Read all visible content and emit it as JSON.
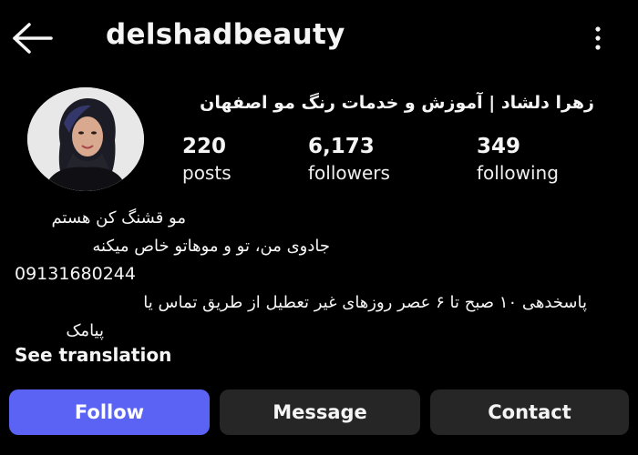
{
  "colors": {
    "background": "#000000",
    "text": "#f5f5f5",
    "follow_button": "#5a63f4",
    "secondary_button": "#262626"
  },
  "header": {
    "back_icon": "arrow-left-icon",
    "username": "delshadbeauty",
    "more_icon": "more-vertical-icon"
  },
  "profile": {
    "avatar_icon": "profile-photo",
    "full_name": "زهرا دلشاد | آموزش و خدمات رنگ مو اصفهان",
    "stats": {
      "posts": {
        "value": "220",
        "label": "posts"
      },
      "followers": {
        "value": "6,173",
        "label": "followers"
      },
      "following": {
        "value": "349",
        "label": "following"
      }
    }
  },
  "bio": {
    "line1": "مو قشنگ کن هستم",
    "line2": "جادوی من، تو و موهاتو خاص میکنه",
    "line3": "09131680244",
    "line4": "پاسخدهی ۱۰ صبح تا ۶ عصر روزهای غیر تعطیل از طریق تماس یا",
    "line5": "پیامک",
    "see_translation": "See translation"
  },
  "actions": {
    "follow": "Follow",
    "message": "Message",
    "contact": "Contact"
  }
}
